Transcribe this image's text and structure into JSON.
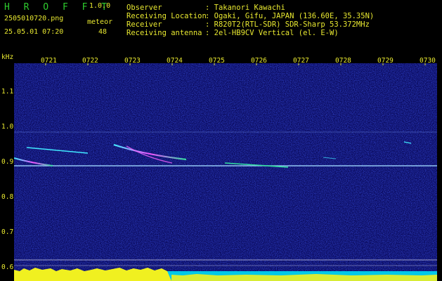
{
  "header": {
    "brand": "H R O F F T",
    "version": "1.0.0",
    "filename": "2505010720.png",
    "datetime": "25.05.01 07:20",
    "meteor_label": "meteor",
    "meteor_count": "48",
    "observer_label": "Observer",
    "observer_value": ": Takanori Kawachi",
    "location_label": "Receiving Location",
    "location_value": ": Ogaki, Gifu, JAPAN (136.60E, 35.35N)",
    "receiver_label": "Receiver",
    "receiver_value": ": R820T2(RTL-SDR) SDR-Sharp 53.372MHz",
    "antenna_label": "Receiving antenna",
    "antenna_value": ": 2el-HB9CV Vertical (el. E-W)"
  },
  "axis": {
    "y_unit": "kHz",
    "y_ticks": [
      "1.1",
      "1.0",
      "0.9",
      "0.8",
      "0.7",
      "0.6"
    ],
    "x_ticks": [
      "0721",
      "0722",
      "0723",
      "0724",
      "0725",
      "0726",
      "0727",
      "0728",
      "0729",
      "0730"
    ]
  },
  "colors": {
    "background": "#000000",
    "waterfall": "#0a0a5c",
    "label_green": "#2ecc2e",
    "label_yellow": "#e8e830"
  }
}
